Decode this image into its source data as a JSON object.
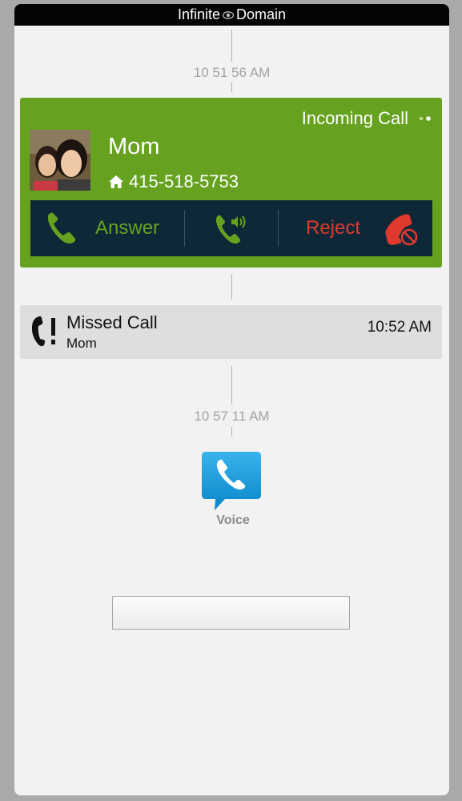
{
  "topbar": {
    "left": "Infinite",
    "right": "Domain"
  },
  "timestamps": [
    "10 51 56 AM",
    "10 57 11 AM"
  ],
  "incoming_call": {
    "title": "Incoming Call",
    "caller_name": "Mom",
    "phone_number": "415-518-5753",
    "answer_label": "Answer",
    "reject_label": "Reject"
  },
  "missed_call": {
    "label": "Missed Call",
    "caller": "Mom",
    "time": "10:52 AM"
  },
  "voice_app": {
    "label": "Voice"
  },
  "colors": {
    "card_green": "#66a220",
    "action_bar": "#0e2838",
    "reject_red": "#e0392e",
    "voice_blue": "#1a9ad6"
  }
}
